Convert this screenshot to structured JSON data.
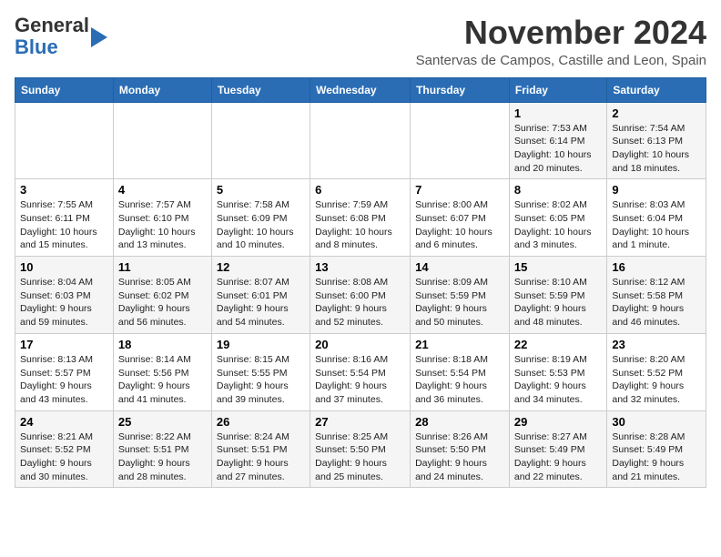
{
  "header": {
    "logo_line1": "General",
    "logo_line2": "Blue",
    "month": "November 2024",
    "location": "Santervas de Campos, Castille and Leon, Spain"
  },
  "days_of_week": [
    "Sunday",
    "Monday",
    "Tuesday",
    "Wednesday",
    "Thursday",
    "Friday",
    "Saturday"
  ],
  "weeks": [
    [
      {
        "day": "",
        "info": ""
      },
      {
        "day": "",
        "info": ""
      },
      {
        "day": "",
        "info": ""
      },
      {
        "day": "",
        "info": ""
      },
      {
        "day": "",
        "info": ""
      },
      {
        "day": "1",
        "info": "Sunrise: 7:53 AM\nSunset: 6:14 PM\nDaylight: 10 hours and 20 minutes."
      },
      {
        "day": "2",
        "info": "Sunrise: 7:54 AM\nSunset: 6:13 PM\nDaylight: 10 hours and 18 minutes."
      }
    ],
    [
      {
        "day": "3",
        "info": "Sunrise: 7:55 AM\nSunset: 6:11 PM\nDaylight: 10 hours and 15 minutes."
      },
      {
        "day": "4",
        "info": "Sunrise: 7:57 AM\nSunset: 6:10 PM\nDaylight: 10 hours and 13 minutes."
      },
      {
        "day": "5",
        "info": "Sunrise: 7:58 AM\nSunset: 6:09 PM\nDaylight: 10 hours and 10 minutes."
      },
      {
        "day": "6",
        "info": "Sunrise: 7:59 AM\nSunset: 6:08 PM\nDaylight: 10 hours and 8 minutes."
      },
      {
        "day": "7",
        "info": "Sunrise: 8:00 AM\nSunset: 6:07 PM\nDaylight: 10 hours and 6 minutes."
      },
      {
        "day": "8",
        "info": "Sunrise: 8:02 AM\nSunset: 6:05 PM\nDaylight: 10 hours and 3 minutes."
      },
      {
        "day": "9",
        "info": "Sunrise: 8:03 AM\nSunset: 6:04 PM\nDaylight: 10 hours and 1 minute."
      }
    ],
    [
      {
        "day": "10",
        "info": "Sunrise: 8:04 AM\nSunset: 6:03 PM\nDaylight: 9 hours and 59 minutes."
      },
      {
        "day": "11",
        "info": "Sunrise: 8:05 AM\nSunset: 6:02 PM\nDaylight: 9 hours and 56 minutes."
      },
      {
        "day": "12",
        "info": "Sunrise: 8:07 AM\nSunset: 6:01 PM\nDaylight: 9 hours and 54 minutes."
      },
      {
        "day": "13",
        "info": "Sunrise: 8:08 AM\nSunset: 6:00 PM\nDaylight: 9 hours and 52 minutes."
      },
      {
        "day": "14",
        "info": "Sunrise: 8:09 AM\nSunset: 5:59 PM\nDaylight: 9 hours and 50 minutes."
      },
      {
        "day": "15",
        "info": "Sunrise: 8:10 AM\nSunset: 5:59 PM\nDaylight: 9 hours and 48 minutes."
      },
      {
        "day": "16",
        "info": "Sunrise: 8:12 AM\nSunset: 5:58 PM\nDaylight: 9 hours and 46 minutes."
      }
    ],
    [
      {
        "day": "17",
        "info": "Sunrise: 8:13 AM\nSunset: 5:57 PM\nDaylight: 9 hours and 43 minutes."
      },
      {
        "day": "18",
        "info": "Sunrise: 8:14 AM\nSunset: 5:56 PM\nDaylight: 9 hours and 41 minutes."
      },
      {
        "day": "19",
        "info": "Sunrise: 8:15 AM\nSunset: 5:55 PM\nDaylight: 9 hours and 39 minutes."
      },
      {
        "day": "20",
        "info": "Sunrise: 8:16 AM\nSunset: 5:54 PM\nDaylight: 9 hours and 37 minutes."
      },
      {
        "day": "21",
        "info": "Sunrise: 8:18 AM\nSunset: 5:54 PM\nDaylight: 9 hours and 36 minutes."
      },
      {
        "day": "22",
        "info": "Sunrise: 8:19 AM\nSunset: 5:53 PM\nDaylight: 9 hours and 34 minutes."
      },
      {
        "day": "23",
        "info": "Sunrise: 8:20 AM\nSunset: 5:52 PM\nDaylight: 9 hours and 32 minutes."
      }
    ],
    [
      {
        "day": "24",
        "info": "Sunrise: 8:21 AM\nSunset: 5:52 PM\nDaylight: 9 hours and 30 minutes."
      },
      {
        "day": "25",
        "info": "Sunrise: 8:22 AM\nSunset: 5:51 PM\nDaylight: 9 hours and 28 minutes."
      },
      {
        "day": "26",
        "info": "Sunrise: 8:24 AM\nSunset: 5:51 PM\nDaylight: 9 hours and 27 minutes."
      },
      {
        "day": "27",
        "info": "Sunrise: 8:25 AM\nSunset: 5:50 PM\nDaylight: 9 hours and 25 minutes."
      },
      {
        "day": "28",
        "info": "Sunrise: 8:26 AM\nSunset: 5:50 PM\nDaylight: 9 hours and 24 minutes."
      },
      {
        "day": "29",
        "info": "Sunrise: 8:27 AM\nSunset: 5:49 PM\nDaylight: 9 hours and 22 minutes."
      },
      {
        "day": "30",
        "info": "Sunrise: 8:28 AM\nSunset: 5:49 PM\nDaylight: 9 hours and 21 minutes."
      }
    ]
  ]
}
